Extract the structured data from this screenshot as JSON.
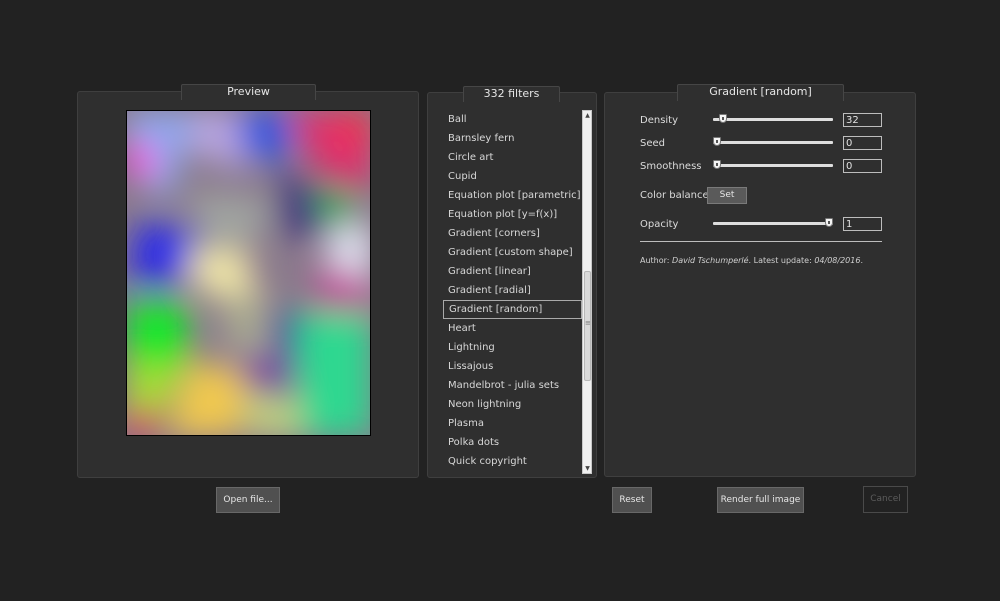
{
  "preview": {
    "title": "Preview",
    "open_label": "Open file..."
  },
  "filters": {
    "title": "332 filters",
    "items": [
      "Ball",
      "Barnsley fern",
      "Circle art",
      "Cupid",
      "Equation plot [parametric]",
      "Equation plot [y=f(x)]",
      "Gradient [corners]",
      "Gradient [custom shape]",
      "Gradient [linear]",
      "Gradient [radial]",
      "Gradient [random]",
      "Heart",
      "Lightning",
      "Lissajous",
      "Mandelbrot - julia sets",
      "Neon lightning",
      "Plasma",
      "Polka dots",
      "Quick copyright"
    ],
    "selected_index": 10,
    "scroll_grip": "≡"
  },
  "params": {
    "title": "Gradient [random]",
    "density_label": "Density",
    "density_value": "32",
    "density_fraction": 0.05,
    "seed_label": "Seed",
    "seed_value": "0",
    "seed_fraction": 0.0,
    "smoothness_label": "Smoothness",
    "smoothness_value": "0",
    "smoothness_fraction": 0.0,
    "color_balance_label": "Color balance",
    "set_label": "Set",
    "opacity_label": "Opacity",
    "opacity_value": "1",
    "opacity_fraction": 1.0,
    "author_prefix": "Author: ",
    "author_name": "David Tschumperlé",
    "update_prefix": ". Latest update: ",
    "update_date": "04/08/2016",
    "update_suffix": "."
  },
  "buttons": {
    "reset": "Reset",
    "render": "Render full image",
    "cancel": "Cancel"
  }
}
